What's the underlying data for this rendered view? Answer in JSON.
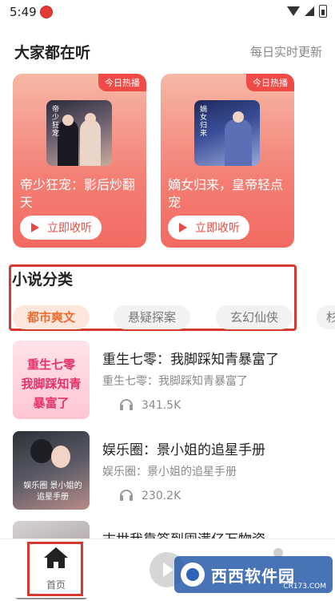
{
  "status_bar": {
    "time": "5:49"
  },
  "popular": {
    "title": "大家都在听",
    "more": "每日实时更新",
    "cards": [
      {
        "tag": "今日热播",
        "title": "帝少狂宠：影后炒翻天",
        "button": "立即收听",
        "cover_text": "帝少狂宠"
      },
      {
        "tag": "今日热播",
        "title": "嫡女归来，皇帝轻点宠",
        "button": "立即收听",
        "cover_text": "嫡女归来"
      }
    ]
  },
  "categories": {
    "title": "小说分类",
    "tabs": [
      "都市爽文",
      "悬疑探案",
      "玄幻仙侠",
      "杉"
    ],
    "selected": "都市爽文"
  },
  "books": [
    {
      "title": "重生七零：我脚踩知青暴富了",
      "subtitle": "重生七零：我脚踩知青暴富了",
      "plays": "341.5K",
      "cover_text": "重生七零 我脚踩知青 暴富了"
    },
    {
      "title": "娱乐圈：景小姐的追星手册",
      "subtitle": "娱乐圈：景小姐的追星手册",
      "plays": "230.2K",
      "cover_text": "娱乐圈 景小姐的追星手册"
    },
    {
      "title": "末世我靠签到囤满亿万物资",
      "subtitle": "",
      "plays": ""
    }
  ],
  "tab_bar": {
    "home_label": "首页"
  },
  "watermark": {
    "text": "西西软件园",
    "sub": "CR173.COM"
  },
  "colors": {
    "accent": "#e34b45",
    "chip_active": "#ee6b2f",
    "highlight_box": "#d6392f"
  }
}
